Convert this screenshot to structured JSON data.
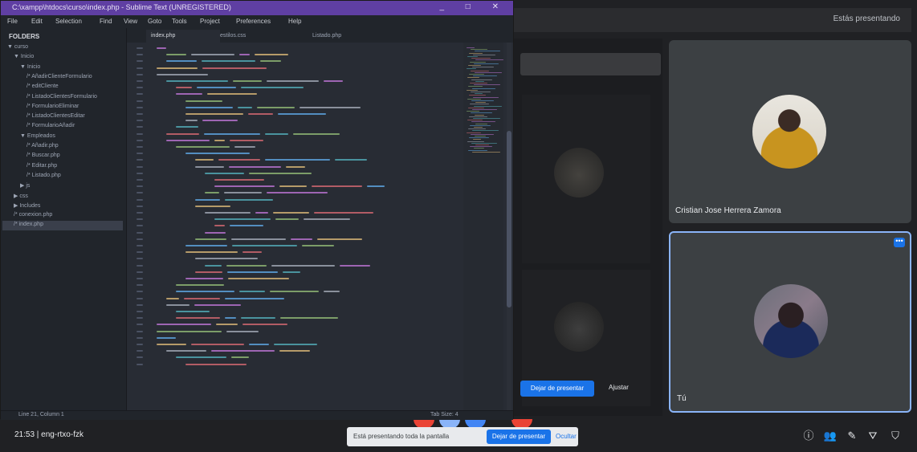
{
  "meet": {
    "present_label": "Estás presentando",
    "participants": [
      {
        "name": "Cristian Jose Herrera Zamora"
      },
      {
        "name": "Tú"
      }
    ],
    "shared_screen": {
      "join_button": "Dejar de presentar",
      "label": "Ajustar"
    },
    "meeting_info": "21:53  |  eng-rtxo-fzk",
    "share_toast": {
      "text": "Está presentando toda la pantalla",
      "stop_button": "Dejar de presentar",
      "hide_button": "Ocultar"
    },
    "bottom_icons": [
      "info-icon",
      "people-icon",
      "chat-icon",
      "activities-icon",
      "shield-icon"
    ],
    "pill_colors": [
      "#ea4335",
      "#8ab4f8",
      "#4285f4",
      "#ea4335"
    ]
  },
  "editor": {
    "title": "C:\\xampp\\htdocs\\curso\\index.php - Sublime Text (UNREGISTERED)",
    "title_controls": "_ □ ✕",
    "menu": [
      "File",
      "Edit",
      "Selection",
      "Find",
      "View",
      "Goto",
      "Tools",
      "Project",
      "Preferences",
      "Help"
    ],
    "sidebar_title": "FOLDERS",
    "tree": [
      {
        "label": "▼ curso",
        "indent": 0
      },
      {
        "label": "▼ Inicio",
        "indent": 1
      },
      {
        "label": "▼ Inicio",
        "indent": 2
      },
      {
        "label": "/* AñadirClienteFormulario",
        "indent": 3
      },
      {
        "label": "/* editCliente",
        "indent": 3
      },
      {
        "label": "/* ListadoClientesFormulario",
        "indent": 3
      },
      {
        "label": "/* FormularioEliminar",
        "indent": 3
      },
      {
        "label": "/* ListadoClientesEditar",
        "indent": 3
      },
      {
        "label": "/* FormularioAñadir",
        "indent": 3
      },
      {
        "label": "▼ Empleados",
        "indent": 2
      },
      {
        "label": "/* Añadir.php",
        "indent": 3
      },
      {
        "label": "/* Buscar.php",
        "indent": 3
      },
      {
        "label": "/* Editar.php",
        "indent": 3
      },
      {
        "label": "/* Listado.php",
        "indent": 3
      },
      {
        "label": "▶ js",
        "indent": 2
      },
      {
        "label": "▶ css",
        "indent": 1
      },
      {
        "label": "▶ Includes",
        "indent": 1
      },
      {
        "label": "/* conexion.php",
        "indent": 1
      },
      {
        "label": "/* index.php",
        "indent": 1
      }
    ],
    "tabs": [
      "index.php",
      "estilos.css",
      "Listado.php"
    ],
    "status_left": "Line 21, Column 1",
    "status_right": "Tab Size: 4"
  }
}
